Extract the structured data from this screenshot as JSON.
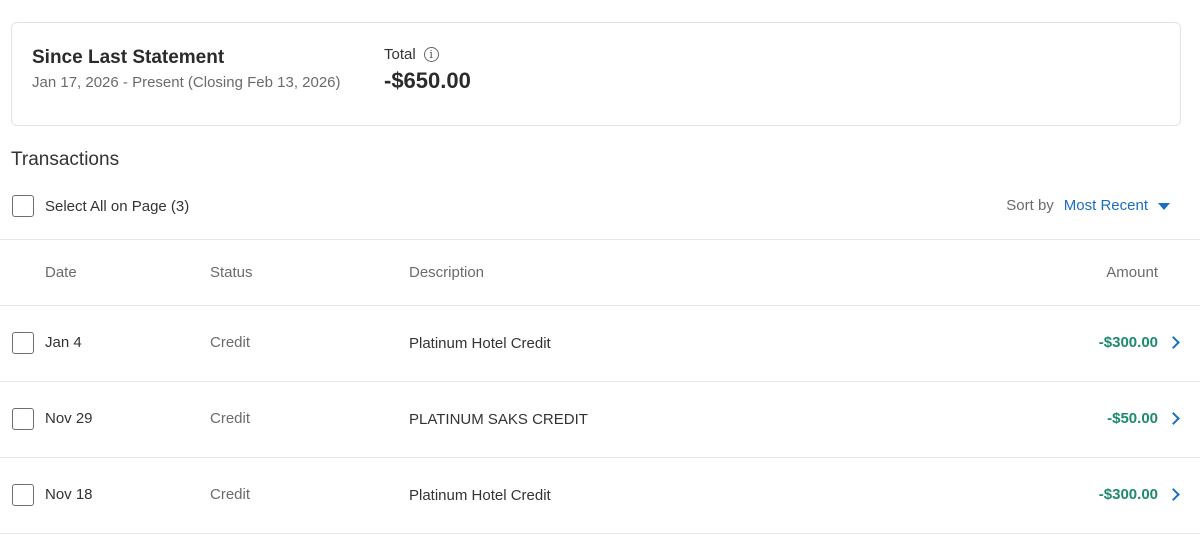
{
  "summary": {
    "title": "Since Last Statement",
    "range": "Jan 17, 2026 - Present (Closing Feb 13, 2026)",
    "total_label": "Total",
    "total_value": "-$650.00"
  },
  "transactions": {
    "title": "Transactions",
    "select_all_label": "Select All on Page (3)",
    "sort_label": "Sort by",
    "sort_value": "Most Recent",
    "columns": {
      "date": "Date",
      "status": "Status",
      "description": "Description",
      "amount": "Amount"
    },
    "rows": [
      {
        "date": "Jan 4",
        "status": "Credit",
        "description": "Platinum Hotel Credit",
        "amount": "-$300.00"
      },
      {
        "date": "Nov 29",
        "status": "Credit",
        "description": "PLATINUM SAKS CREDIT",
        "amount": "-$50.00"
      },
      {
        "date": "Nov 18",
        "status": "Credit",
        "description": "Platinum Hotel Credit",
        "amount": "-$300.00"
      }
    ]
  },
  "colors": {
    "accent": "#1a6ec1",
    "credit_amount": "#1e8a6e"
  },
  "icons": [
    "info-icon",
    "caret-down-icon",
    "chevron-right-icon",
    "checkbox"
  ]
}
